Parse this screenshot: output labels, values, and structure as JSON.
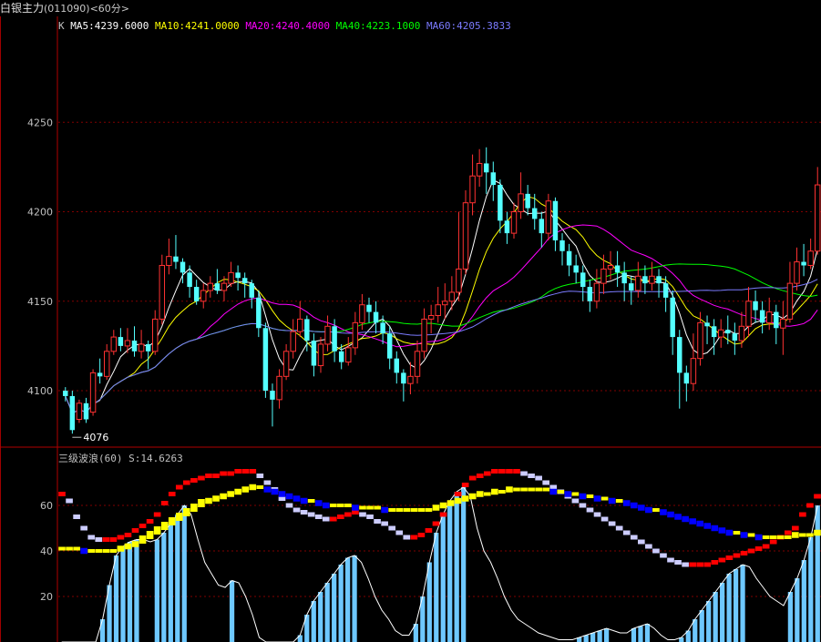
{
  "window": {
    "title": "白银主力",
    "code": "(011090)",
    "period": "<60分>"
  },
  "colors": {
    "up": "#ff3232",
    "down": "#54ffff",
    "grid": "#800000",
    "border": "#b00000",
    "axis_text": "#c0c0c0",
    "ma5": "#ffffff",
    "ma10": "#ffff00",
    "ma20": "#ff00ff",
    "ma40": "#00ff00",
    "ma60": "#7b7bff"
  },
  "legend": {
    "k_label": "K",
    "ma5": "MA5:4239.6000",
    "ma10": "MA10:4241.0000",
    "ma20": "MA20:4240.4000",
    "ma40": "MA40:4223.1000",
    "ma60": "MA60:4205.3833"
  },
  "low_marker": {
    "label": "4076",
    "value": 4076
  },
  "indicator": {
    "name": "三级波浪(60)",
    "value_label": "S:14.6263"
  },
  "chart_data": [
    {
      "type": "candlestick",
      "title": "",
      "ylim": [
        4070,
        4300
      ],
      "yticks": [
        4100,
        4150,
        4200,
        4250
      ],
      "grid": true,
      "candles": [
        [
          4100,
          4097,
          4102,
          4094
        ],
        [
          4097,
          4078,
          4100,
          4076
        ],
        [
          4084,
          4093,
          4095,
          4082
        ],
        [
          4093,
          4084,
          4096,
          4082
        ],
        [
          4088,
          4110,
          4112,
          4086
        ],
        [
          4110,
          4108,
          4118,
          4104
        ],
        [
          4108,
          4122,
          4126,
          4106
        ],
        [
          4122,
          4130,
          4134,
          4120
        ],
        [
          4130,
          4125,
          4135,
          4122
        ],
        [
          4125,
          4128,
          4135,
          4121
        ],
        [
          4128,
          4122,
          4136,
          4119
        ],
        [
          4122,
          4126,
          4134,
          4118
        ],
        [
          4126,
          4122,
          4128,
          4112
        ],
        [
          4122,
          4140,
          4145,
          4120
        ],
        [
          4140,
          4170,
          4176,
          4137
        ],
        [
          4170,
          4175,
          4185,
          4165
        ],
        [
          4175,
          4172,
          4187,
          4168
        ],
        [
          4172,
          4166,
          4174,
          4160
        ],
        [
          4166,
          4158,
          4170,
          4152
        ],
        [
          4158,
          4150,
          4162,
          4148
        ],
        [
          4150,
          4156,
          4160,
          4146
        ],
        [
          4156,
          4160,
          4164,
          4152
        ],
        [
          4160,
          4156,
          4168,
          4154
        ],
        [
          4156,
          4160,
          4164,
          4150
        ],
        [
          4160,
          4166,
          4172,
          4158
        ],
        [
          4166,
          4163,
          4170,
          4156
        ],
        [
          4163,
          4160,
          4166,
          4152
        ],
        [
          4160,
          4152,
          4162,
          4146
        ],
        [
          4152,
          4135,
          4156,
          4130
        ],
        [
          4135,
          4100,
          4138,
          4096
        ],
        [
          4100,
          4095,
          4104,
          4080
        ],
        [
          4095,
          4108,
          4112,
          4090
        ],
        [
          4108,
          4122,
          4126,
          4106
        ],
        [
          4122,
          4133,
          4140,
          4118
        ],
        [
          4133,
          4140,
          4150,
          4130
        ],
        [
          4140,
          4128,
          4142,
          4122
        ],
        [
          4128,
          4114,
          4132,
          4108
        ],
        [
          4114,
          4126,
          4130,
          4110
        ],
        [
          4126,
          4136,
          4142,
          4122
        ],
        [
          4136,
          4122,
          4140,
          4116
        ],
        [
          4122,
          4116,
          4126,
          4112
        ],
        [
          4116,
          4124,
          4130,
          4114
        ],
        [
          4124,
          4138,
          4144,
          4120
        ],
        [
          4138,
          4148,
          4154,
          4134
        ],
        [
          4148,
          4144,
          4152,
          4138
        ],
        [
          4144,
          4138,
          4150,
          4132
        ],
        [
          4138,
          4132,
          4142,
          4126
        ],
        [
          4132,
          4118,
          4136,
          4112
        ],
        [
          4118,
          4110,
          4122,
          4104
        ],
        [
          4110,
          4104,
          4112,
          4094
        ],
        [
          4104,
          4108,
          4116,
          4098
        ],
        [
          4108,
          4122,
          4128,
          4104
        ],
        [
          4122,
          4140,
          4146,
          4118
        ],
        [
          4140,
          4142,
          4148,
          4132
        ],
        [
          4142,
          4148,
          4158,
          4138
        ],
        [
          4148,
          4150,
          4160,
          4140
        ],
        [
          4150,
          4155,
          4164,
          4145
        ],
        [
          4155,
          4168,
          4200,
          4150
        ],
        [
          4168,
          4205,
          4212,
          4165
        ],
        [
          4205,
          4220,
          4232,
          4198
        ],
        [
          4220,
          4227,
          4235,
          4214
        ],
        [
          4227,
          4222,
          4236,
          4210
        ],
        [
          4222,
          4215,
          4228,
          4206
        ],
        [
          4215,
          4195,
          4218,
          4188
        ],
        [
          4195,
          4188,
          4200,
          4182
        ],
        [
          4188,
          4200,
          4205,
          4185
        ],
        [
          4200,
          4210,
          4222,
          4196
        ],
        [
          4210,
          4202,
          4215,
          4198
        ],
        [
          4202,
          4196,
          4210,
          4190
        ],
        [
          4196,
          4188,
          4200,
          4180
        ],
        [
          4188,
          4206,
          4210,
          4184
        ],
        [
          4206,
          4184,
          4208,
          4178
        ],
        [
          4184,
          4178,
          4188,
          4170
        ],
        [
          4178,
          4170,
          4182,
          4164
        ],
        [
          4170,
          4166,
          4176,
          4160
        ],
        [
          4166,
          4158,
          4170,
          4150
        ],
        [
          4158,
          4150,
          4162,
          4144
        ],
        [
          4150,
          4160,
          4168,
          4146
        ],
        [
          4160,
          4168,
          4176,
          4154
        ],
        [
          4168,
          4170,
          4178,
          4162
        ],
        [
          4170,
          4166,
          4178,
          4158
        ],
        [
          4166,
          4160,
          4172,
          4150
        ],
        [
          4160,
          4156,
          4164,
          4148
        ],
        [
          4156,
          4164,
          4172,
          4152
        ],
        [
          4164,
          4160,
          4170,
          4154
        ],
        [
          4160,
          4164,
          4172,
          4156
        ],
        [
          4164,
          4160,
          4168,
          4152
        ],
        [
          4160,
          4152,
          4164,
          4144
        ],
        [
          4152,
          4130,
          4156,
          4120
        ],
        [
          4130,
          4110,
          4134,
          4090
        ],
        [
          4110,
          4104,
          4114,
          4094
        ],
        [
          4104,
          4118,
          4132,
          4100
        ],
        [
          4118,
          4138,
          4144,
          4114
        ],
        [
          4138,
          4136,
          4142,
          4126
        ],
        [
          4136,
          4130,
          4140,
          4120
        ],
        [
          4130,
          4134,
          4140,
          4124
        ],
        [
          4134,
          4132,
          4142,
          4126
        ],
        [
          4132,
          4128,
          4138,
          4120
        ],
        [
          4128,
          4136,
          4144,
          4124
        ],
        [
          4136,
          4150,
          4158,
          4130
        ],
        [
          4150,
          4145,
          4156,
          4138
        ],
        [
          4145,
          4138,
          4150,
          4132
        ],
        [
          4138,
          4144,
          4152,
          4134
        ],
        [
          4144,
          4135,
          4148,
          4126
        ],
        [
          4135,
          4140,
          4150,
          4120
        ],
        [
          4140,
          4160,
          4172,
          4138
        ],
        [
          4160,
          4172,
          4180,
          4156
        ],
        [
          4172,
          4170,
          4182,
          4164
        ],
        [
          4170,
          4178,
          4185,
          4168
        ],
        [
          4178,
          4215,
          4225,
          4176
        ]
      ]
    },
    {
      "type": "line",
      "title": "三级波浪(60)",
      "ylim": [
        0,
        78
      ],
      "yticks": [
        20,
        40,
        60
      ],
      "grid": true,
      "series": [
        {
          "name": "S",
          "color": "#ffffff",
          "values": [
            0,
            0,
            0,
            0,
            0,
            0,
            10,
            25,
            38,
            42,
            44,
            45,
            45,
            44,
            45,
            48,
            52,
            56,
            60,
            56,
            45,
            35,
            30,
            25,
            24,
            27,
            26,
            20,
            12,
            2,
            0,
            0,
            0,
            0,
            0,
            3,
            12,
            18,
            22,
            26,
            30,
            34,
            37,
            38,
            35,
            28,
            20,
            14,
            10,
            5,
            3,
            3,
            8,
            20,
            35,
            48,
            56,
            62,
            66,
            68,
            64,
            50,
            40,
            35,
            28,
            20,
            14,
            10,
            8,
            6,
            4,
            3,
            2,
            1,
            1,
            1,
            2,
            3,
            4,
            5,
            6,
            5,
            4,
            4,
            6,
            7,
            8,
            6,
            3,
            1,
            1,
            2,
            5,
            10,
            14,
            18,
            22,
            26,
            30,
            32,
            34,
            33,
            28,
            24,
            20,
            18,
            16,
            22,
            28,
            36,
            46,
            60
          ]
        }
      ],
      "ribbons": [
        {
          "name": "",
          "colors": [
            "#ff0000",
            "#ccccff"
          ],
          "values": [
            65,
            62,
            55,
            50,
            46,
            45,
            45,
            45,
            46,
            47,
            49,
            51,
            53,
            56,
            61,
            65,
            68,
            70,
            71,
            72,
            73,
            73,
            74,
            74,
            75,
            75,
            75,
            73,
            70,
            67,
            63,
            60,
            58,
            57,
            56,
            55,
            54,
            54,
            55,
            56,
            57,
            56,
            55,
            53,
            52,
            50,
            48,
            46,
            46,
            47,
            49,
            52,
            56,
            61,
            65,
            69,
            72,
            73,
            74,
            75,
            75,
            75,
            75,
            74,
            73,
            72,
            70,
            68,
            66,
            64,
            62,
            60,
            58,
            56,
            54,
            52,
            50,
            48,
            46,
            44,
            42,
            40,
            38,
            36,
            35,
            34,
            34,
            34,
            34,
            35,
            36,
            37,
            38,
            39,
            40,
            41,
            42,
            44,
            46,
            48,
            50,
            56,
            60,
            64
          ]
        },
        {
          "name": "",
          "colors": [
            "#ffff00",
            "#0000ff"
          ],
          "values": [
            41,
            41,
            41,
            40,
            40,
            40,
            40,
            40,
            41,
            42,
            43,
            45,
            47,
            49,
            51,
            53,
            55,
            57,
            59,
            61,
            62,
            63,
            64,
            65,
            66,
            67,
            68,
            68,
            67,
            66,
            65,
            64,
            63,
            62,
            62,
            61,
            60,
            60,
            60,
            60,
            59,
            59,
            59,
            59,
            58,
            58,
            58,
            58,
            58,
            58,
            58,
            59,
            60,
            61,
            62,
            63,
            64,
            65,
            65,
            66,
            66,
            67,
            67,
            67,
            67,
            67,
            67,
            66,
            66,
            65,
            65,
            64,
            64,
            63,
            63,
            62,
            62,
            61,
            60,
            59,
            58,
            58,
            57,
            56,
            55,
            54,
            53,
            52,
            51,
            50,
            49,
            48,
            48,
            47,
            47,
            46,
            46,
            46,
            46,
            46,
            47,
            47,
            47,
            48
          ]
        }
      ]
    }
  ]
}
